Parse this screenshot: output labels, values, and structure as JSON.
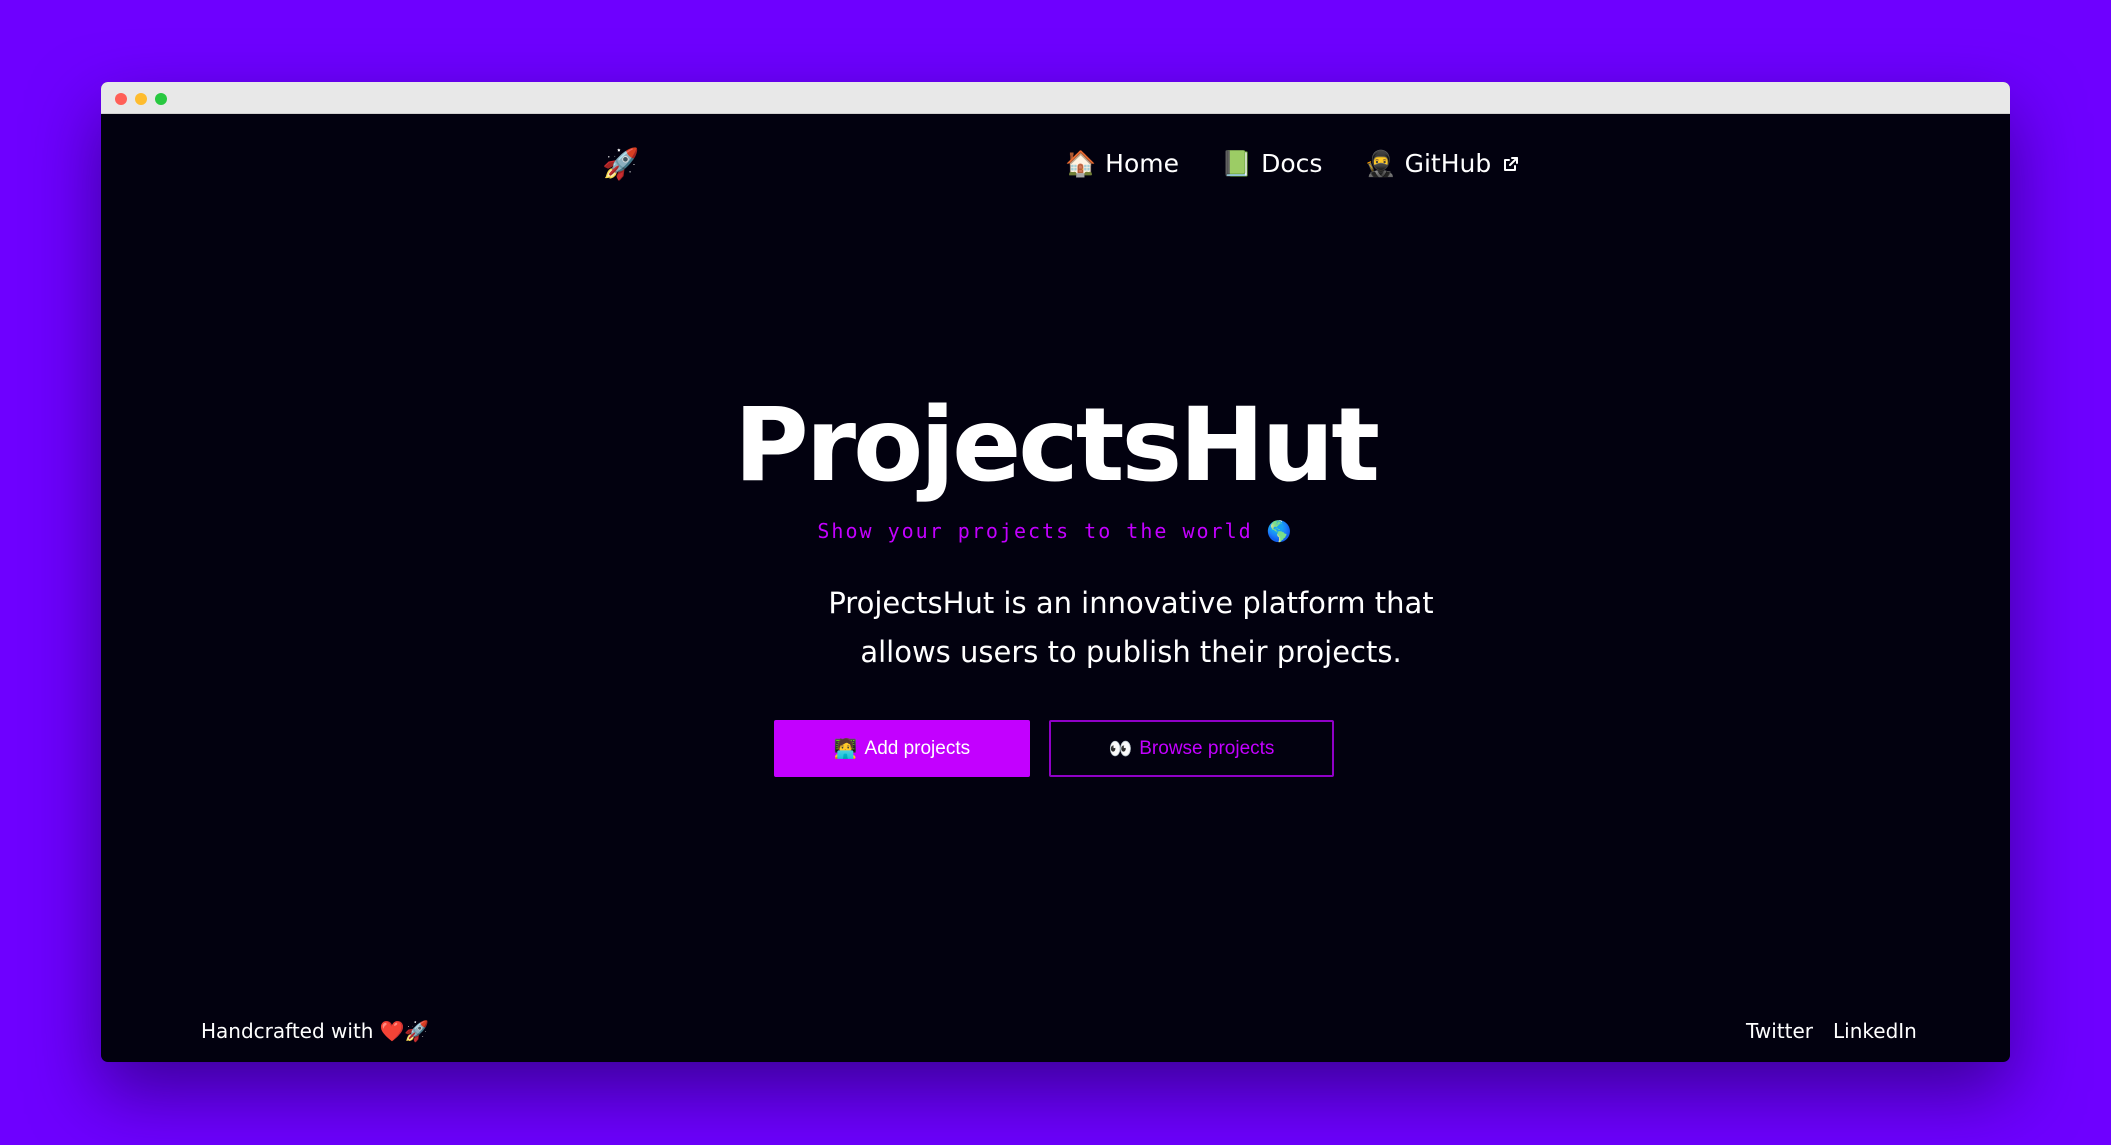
{
  "window": {
    "controls": [
      "close",
      "minimize",
      "maximize"
    ]
  },
  "header": {
    "logo_icon": "🚀",
    "nav": [
      {
        "icon": "🏠",
        "label": "Home",
        "icon_name": "house-icon"
      },
      {
        "icon": "📗",
        "label": "Docs",
        "icon_name": "green-book-icon"
      },
      {
        "icon": "🥷",
        "label": "GitHub",
        "icon_name": "ninja-icon",
        "external": true
      }
    ]
  },
  "hero": {
    "title": "ProjectsHut",
    "subtitle": "Show your projects to the world 🌎",
    "description": "ProjectsHut is an innovative platform that allows users to publish their projects.",
    "primary_button": {
      "icon": "🧑‍💻",
      "label": "Add projects"
    },
    "secondary_button": {
      "icon": "👀",
      "label": "Browse projects"
    }
  },
  "footer": {
    "credit_text": "Handcrafted with",
    "credit_icons": "❤️🚀",
    "links": [
      "Twitter",
      "LinkedIn"
    ]
  },
  "colors": {
    "background": "#6e00ff",
    "page": "#02010f",
    "accent": "#c300ff"
  }
}
